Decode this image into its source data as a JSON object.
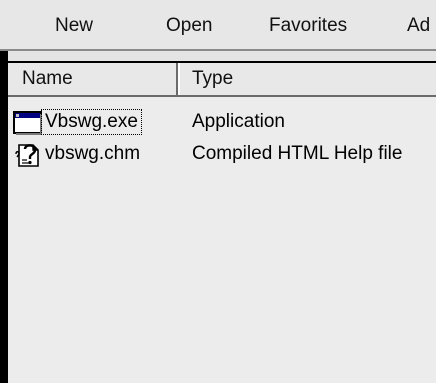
{
  "toolbar": {
    "new_label": "New",
    "open_label": "Open",
    "favorites_label": "Favorites",
    "ad_label": "Ad"
  },
  "list": {
    "columns": {
      "name": "Name",
      "type": "Type"
    },
    "rows": [
      {
        "name": "Vbswg.exe",
        "type": "Application",
        "icon": "application-window-icon"
      },
      {
        "name": "vbswg.chm",
        "type": "Compiled HTML Help file",
        "icon": "help-file-icon"
      }
    ]
  }
}
